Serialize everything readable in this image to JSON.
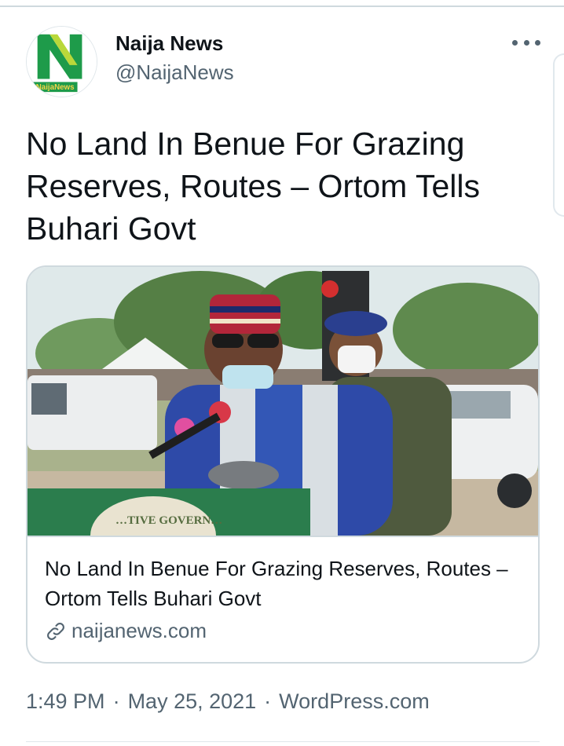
{
  "tweet": {
    "author_name": "Naija News",
    "author_handle": "@NaijaNews",
    "avatar_logo_text": "NaijaNews",
    "text": "No Land In Benue For Grazing Reserves, Routes – Ortom Tells Buhari Govt",
    "more_icon": "more-horizontal-icon",
    "time": "1:49 PM",
    "date": "May 25, 2021",
    "source": "WordPress.com",
    "separator": "·"
  },
  "card": {
    "title": "No Land In Benue For Grazing Reserves, Routes – Ortom Tells Buhari Govt",
    "domain": "naijanews.com",
    "link_icon": "link-icon",
    "image_podium_text": "…TIVE GOVERN…"
  },
  "colors": {
    "text_primary": "#0f1419",
    "text_secondary": "#536471",
    "border": "#cfd9de",
    "avatar_green": "#1e9b4a"
  }
}
